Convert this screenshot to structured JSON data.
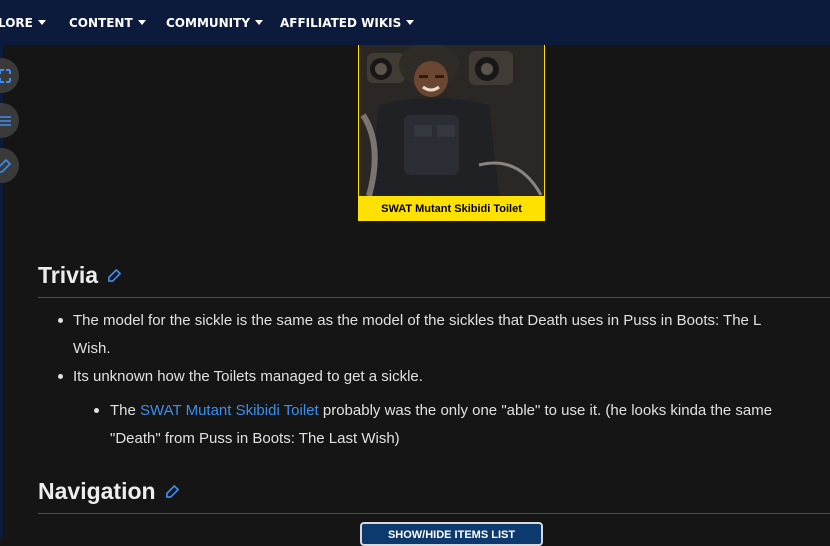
{
  "nav": {
    "items": [
      {
        "label": "LORE"
      },
      {
        "label": "CONTENT"
      },
      {
        "label": "COMMUNITY"
      },
      {
        "label": "AFFILIATED WIKIS"
      }
    ]
  },
  "sidetools": [
    "fullscreen-icon",
    "list-icon",
    "edit-icon"
  ],
  "figure": {
    "caption": "SWAT Mutant Skibidi Toilet"
  },
  "trivia": {
    "heading": "Trivia",
    "b1_line1": "The model for the sickle is the same as the model of the sickles that Death uses in Puss in Boots: The L",
    "b1_line2": "Wish.",
    "b2": "Its unknown how the Toilets managed to get a sickle.",
    "b3_pre": "The ",
    "b3_link": "SWAT Mutant Skibidi Toilet",
    "b3_post": " probably was the only one \"able\" to use it. (he looks kinda the same",
    "b3_line2": "\"Death\" from Puss in Boots: The Last Wish)"
  },
  "navigation": {
    "heading": "Navigation",
    "button": "SHOW/HIDE ITEMS LIST"
  },
  "colors": {
    "nav_bg": "#0c1a3c",
    "caption_bg": "#ffe100",
    "link": "#3d8ef0",
    "edit_icon": "#3d8ef0"
  }
}
